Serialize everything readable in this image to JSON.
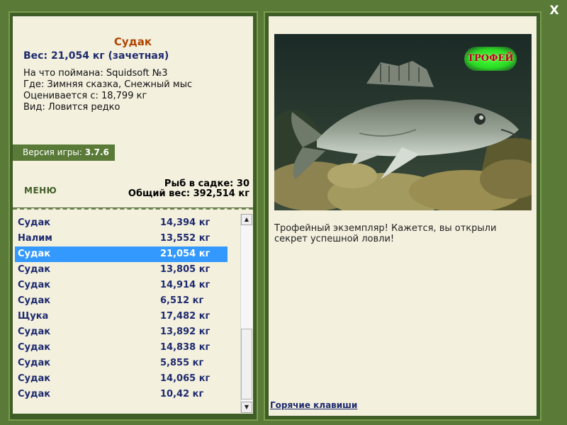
{
  "close": {
    "label": "X"
  },
  "fish": {
    "title": "Судак",
    "weight_line": "Вес: 21,054 кг (зачетная)",
    "caught_with": "На что поймана: Squidsoft №3",
    "location": "Где: Зимняя сказка, Снежный мыс",
    "valued_from": "Оценивается с: 18,799 кг",
    "kind": "Вид: Ловится редко"
  },
  "version": {
    "label": "Версия игры: ",
    "value": "3.7.6"
  },
  "menu": {
    "label": "МЕНЮ"
  },
  "stats": {
    "fish_in_cage": "Рыб в садке: 30",
    "total_weight": "Общий вес: 392,514 кг"
  },
  "catch_list": [
    {
      "name": "Судак",
      "weight": "14,394 кг",
      "selected": false
    },
    {
      "name": "Налим",
      "weight": "13,552 кг",
      "selected": false
    },
    {
      "name": "Судак",
      "weight": "21,054 кг",
      "selected": true
    },
    {
      "name": "Судак",
      "weight": "13,805 кг",
      "selected": false
    },
    {
      "name": "Судак",
      "weight": "14,914 кг",
      "selected": false
    },
    {
      "name": "Судак",
      "weight": "6,512 кг",
      "selected": false
    },
    {
      "name": "Щука",
      "weight": "17,482 кг",
      "selected": false
    },
    {
      "name": "Судак",
      "weight": "13,892 кг",
      "selected": false
    },
    {
      "name": "Судак",
      "weight": "14,838 кг",
      "selected": false
    },
    {
      "name": "Судак",
      "weight": "5,855 кг",
      "selected": false
    },
    {
      "name": "Судак",
      "weight": "14,065 кг",
      "selected": false
    },
    {
      "name": "Судак",
      "weight": "10,42 кг",
      "selected": false
    }
  ],
  "trophy": {
    "badge": "ТРОФЕЙ",
    "text": "Трофейный экземпляр! Кажется, вы открыли секрет успешной ловли!"
  },
  "hotkeys": {
    "label": "Горячие клавиши"
  },
  "colors": {
    "background": "#5a7a38",
    "panel": "#f3f0de",
    "title": "#b04400",
    "text_blue": "#1e2a6e",
    "selection": "#3399ff",
    "trophy_glow": "#43ff38",
    "trophy_text": "#b4002a"
  },
  "icons": {
    "close": "close-icon",
    "scroll_up": "arrow-up-icon",
    "scroll_down": "arrow-down-icon"
  }
}
